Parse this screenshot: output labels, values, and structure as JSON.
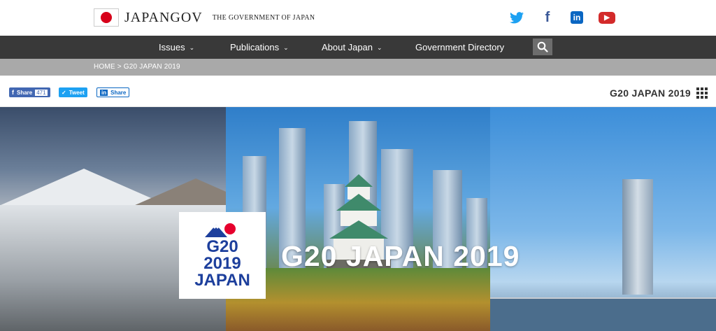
{
  "header": {
    "logo_text": "JAPANGOV",
    "logo_sub": "The Government of Japan",
    "socials": [
      {
        "name": "twitter",
        "glyph": "🐦"
      },
      {
        "name": "facebook",
        "glyph": "f"
      },
      {
        "name": "linkedin",
        "glyph": "in"
      },
      {
        "name": "youtube",
        "glyph": "▶"
      }
    ]
  },
  "nav": {
    "items": [
      {
        "label": "Issues",
        "chevron": "⌄"
      },
      {
        "label": "Publications",
        "chevron": "⌄"
      },
      {
        "label": "About Japan",
        "chevron": "⌄"
      },
      {
        "label": "Government Directory",
        "chevron": ""
      }
    ],
    "search_icon": "magnifier-icon"
  },
  "breadcrumb": {
    "text": "HOME > G20 JAPAN 2019"
  },
  "share": {
    "facebook_label": "Share",
    "facebook_count": "471",
    "twitter_label": "Tweet",
    "linkedin_label": "Share"
  },
  "page_tag": "G20 JAPAN 2019",
  "hero": {
    "title": "G20 JAPAN 2019",
    "logo_lines": [
      "G20",
      "2019",
      "JAPAN"
    ]
  },
  "colors": {
    "nav_bg": "#393939",
    "breadcrumb_bg": "#a9a9a9",
    "flag_red": "#d7001a",
    "logo_blue": "#1d3f9c"
  }
}
